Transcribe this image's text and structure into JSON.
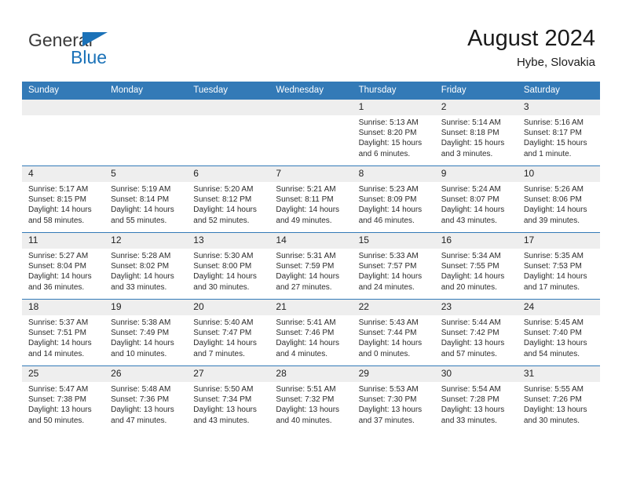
{
  "brand": {
    "name_part1": "General",
    "name_part2": "Blue",
    "accent_color": "#1b72b8"
  },
  "header": {
    "title": "August 2024",
    "subtitle": "Hybe, Slovakia"
  },
  "calendar": {
    "header_bg": "#337ab7",
    "daynum_bg": "#eeeeee",
    "weekdays": [
      "Sunday",
      "Monday",
      "Tuesday",
      "Wednesday",
      "Thursday",
      "Friday",
      "Saturday"
    ],
    "weeks": [
      [
        {
          "day": "",
          "sunrise": "",
          "sunset": "",
          "daylight": ""
        },
        {
          "day": "",
          "sunrise": "",
          "sunset": "",
          "daylight": ""
        },
        {
          "day": "",
          "sunrise": "",
          "sunset": "",
          "daylight": ""
        },
        {
          "day": "",
          "sunrise": "",
          "sunset": "",
          "daylight": ""
        },
        {
          "day": "1",
          "sunrise": "Sunrise: 5:13 AM",
          "sunset": "Sunset: 8:20 PM",
          "daylight": "Daylight: 15 hours and 6 minutes."
        },
        {
          "day": "2",
          "sunrise": "Sunrise: 5:14 AM",
          "sunset": "Sunset: 8:18 PM",
          "daylight": "Daylight: 15 hours and 3 minutes."
        },
        {
          "day": "3",
          "sunrise": "Sunrise: 5:16 AM",
          "sunset": "Sunset: 8:17 PM",
          "daylight": "Daylight: 15 hours and 1 minute."
        }
      ],
      [
        {
          "day": "4",
          "sunrise": "Sunrise: 5:17 AM",
          "sunset": "Sunset: 8:15 PM",
          "daylight": "Daylight: 14 hours and 58 minutes."
        },
        {
          "day": "5",
          "sunrise": "Sunrise: 5:19 AM",
          "sunset": "Sunset: 8:14 PM",
          "daylight": "Daylight: 14 hours and 55 minutes."
        },
        {
          "day": "6",
          "sunrise": "Sunrise: 5:20 AM",
          "sunset": "Sunset: 8:12 PM",
          "daylight": "Daylight: 14 hours and 52 minutes."
        },
        {
          "day": "7",
          "sunrise": "Sunrise: 5:21 AM",
          "sunset": "Sunset: 8:11 PM",
          "daylight": "Daylight: 14 hours and 49 minutes."
        },
        {
          "day": "8",
          "sunrise": "Sunrise: 5:23 AM",
          "sunset": "Sunset: 8:09 PM",
          "daylight": "Daylight: 14 hours and 46 minutes."
        },
        {
          "day": "9",
          "sunrise": "Sunrise: 5:24 AM",
          "sunset": "Sunset: 8:07 PM",
          "daylight": "Daylight: 14 hours and 43 minutes."
        },
        {
          "day": "10",
          "sunrise": "Sunrise: 5:26 AM",
          "sunset": "Sunset: 8:06 PM",
          "daylight": "Daylight: 14 hours and 39 minutes."
        }
      ],
      [
        {
          "day": "11",
          "sunrise": "Sunrise: 5:27 AM",
          "sunset": "Sunset: 8:04 PM",
          "daylight": "Daylight: 14 hours and 36 minutes."
        },
        {
          "day": "12",
          "sunrise": "Sunrise: 5:28 AM",
          "sunset": "Sunset: 8:02 PM",
          "daylight": "Daylight: 14 hours and 33 minutes."
        },
        {
          "day": "13",
          "sunrise": "Sunrise: 5:30 AM",
          "sunset": "Sunset: 8:00 PM",
          "daylight": "Daylight: 14 hours and 30 minutes."
        },
        {
          "day": "14",
          "sunrise": "Sunrise: 5:31 AM",
          "sunset": "Sunset: 7:59 PM",
          "daylight": "Daylight: 14 hours and 27 minutes."
        },
        {
          "day": "15",
          "sunrise": "Sunrise: 5:33 AM",
          "sunset": "Sunset: 7:57 PM",
          "daylight": "Daylight: 14 hours and 24 minutes."
        },
        {
          "day": "16",
          "sunrise": "Sunrise: 5:34 AM",
          "sunset": "Sunset: 7:55 PM",
          "daylight": "Daylight: 14 hours and 20 minutes."
        },
        {
          "day": "17",
          "sunrise": "Sunrise: 5:35 AM",
          "sunset": "Sunset: 7:53 PM",
          "daylight": "Daylight: 14 hours and 17 minutes."
        }
      ],
      [
        {
          "day": "18",
          "sunrise": "Sunrise: 5:37 AM",
          "sunset": "Sunset: 7:51 PM",
          "daylight": "Daylight: 14 hours and 14 minutes."
        },
        {
          "day": "19",
          "sunrise": "Sunrise: 5:38 AM",
          "sunset": "Sunset: 7:49 PM",
          "daylight": "Daylight: 14 hours and 10 minutes."
        },
        {
          "day": "20",
          "sunrise": "Sunrise: 5:40 AM",
          "sunset": "Sunset: 7:47 PM",
          "daylight": "Daylight: 14 hours and 7 minutes."
        },
        {
          "day": "21",
          "sunrise": "Sunrise: 5:41 AM",
          "sunset": "Sunset: 7:46 PM",
          "daylight": "Daylight: 14 hours and 4 minutes."
        },
        {
          "day": "22",
          "sunrise": "Sunrise: 5:43 AM",
          "sunset": "Sunset: 7:44 PM",
          "daylight": "Daylight: 14 hours and 0 minutes."
        },
        {
          "day": "23",
          "sunrise": "Sunrise: 5:44 AM",
          "sunset": "Sunset: 7:42 PM",
          "daylight": "Daylight: 13 hours and 57 minutes."
        },
        {
          "day": "24",
          "sunrise": "Sunrise: 5:45 AM",
          "sunset": "Sunset: 7:40 PM",
          "daylight": "Daylight: 13 hours and 54 minutes."
        }
      ],
      [
        {
          "day": "25",
          "sunrise": "Sunrise: 5:47 AM",
          "sunset": "Sunset: 7:38 PM",
          "daylight": "Daylight: 13 hours and 50 minutes."
        },
        {
          "day": "26",
          "sunrise": "Sunrise: 5:48 AM",
          "sunset": "Sunset: 7:36 PM",
          "daylight": "Daylight: 13 hours and 47 minutes."
        },
        {
          "day": "27",
          "sunrise": "Sunrise: 5:50 AM",
          "sunset": "Sunset: 7:34 PM",
          "daylight": "Daylight: 13 hours and 43 minutes."
        },
        {
          "day": "28",
          "sunrise": "Sunrise: 5:51 AM",
          "sunset": "Sunset: 7:32 PM",
          "daylight": "Daylight: 13 hours and 40 minutes."
        },
        {
          "day": "29",
          "sunrise": "Sunrise: 5:53 AM",
          "sunset": "Sunset: 7:30 PM",
          "daylight": "Daylight: 13 hours and 37 minutes."
        },
        {
          "day": "30",
          "sunrise": "Sunrise: 5:54 AM",
          "sunset": "Sunset: 7:28 PM",
          "daylight": "Daylight: 13 hours and 33 minutes."
        },
        {
          "day": "31",
          "sunrise": "Sunrise: 5:55 AM",
          "sunset": "Sunset: 7:26 PM",
          "daylight": "Daylight: 13 hours and 30 minutes."
        }
      ]
    ]
  }
}
